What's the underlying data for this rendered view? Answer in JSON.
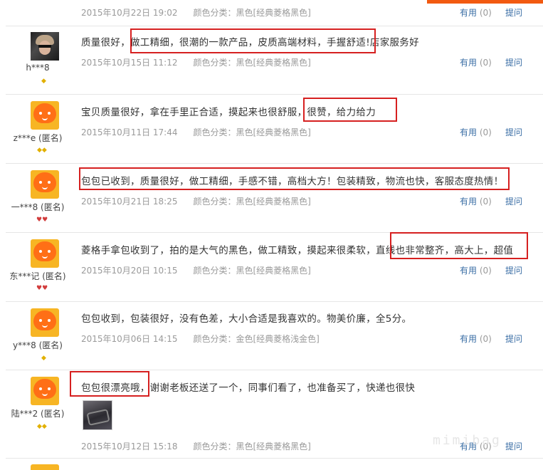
{
  "actions": {
    "useful_label": "有用",
    "ask_label": "提问"
  },
  "watermark": "mimibag",
  "top_partial": {
    "date": "2015年10月22日 19:02",
    "color": "颜色分类：黑色[经典菱格黑色]",
    "useful_count": "(0)"
  },
  "reviews": [
    {
      "user": "h***8",
      "badge": "◆",
      "content": "质量很好，做工精细，很潮的一款产品，皮质高端材料，手握舒适!店家服务好",
      "date": "2015年10月15日 11:12",
      "color": "颜色分类：黑色[经典菱格黑色]",
      "useful_count": "(0)"
    },
    {
      "user": "z***e (匿名)",
      "badge": "◆◆",
      "content": "宝贝质量很好，拿在手里正合适，摸起来也很舒服，很赞，给力给力",
      "date": "2015年10月11日 17:44",
      "color": "颜色分类：黑色[经典菱格黑色]",
      "useful_count": "(0)"
    },
    {
      "user": "一***8 (匿名)",
      "badge": "♥♥",
      "content": "包包已收到，质量很好，做工精细，手感不错，高档大方！包装精致，物流也快，客服态度热情！",
      "date": "2015年10月21日 18:25",
      "color": "颜色分类：黑色[经典菱格黑色]",
      "useful_count": "(0)"
    },
    {
      "user": "东***记 (匿名)",
      "badge": "♥♥",
      "content": "菱格手拿包收到了，拍的是大气的黑色，做工精致，摸起来很柔软，直线也非常整齐，高大上，超值",
      "date": "2015年10月20日 10:15",
      "color": "颜色分类：黑色[经典菱格黑色]",
      "useful_count": "(0)"
    },
    {
      "user": "y***8 (匿名)",
      "badge": "◆",
      "content": "包包收到，包装很好，没有色差，大小合适是我喜欢的。物美价廉，全5分。",
      "date": "2015年10月06日 14:15",
      "color": "颜色分类：金色[经典菱格浅金色]",
      "useful_count": "(0)"
    },
    {
      "user": "陆***2 (匿名)",
      "badge": "◆◆",
      "content": "包包很漂亮哦，谢谢老板还送了一个，同事们看了，也准备买了，快递也很快",
      "date": "2015年10月12日 15:18",
      "color": "颜色分类：黑色[经典菱格黑色]",
      "useful_count": "(0)"
    }
  ]
}
